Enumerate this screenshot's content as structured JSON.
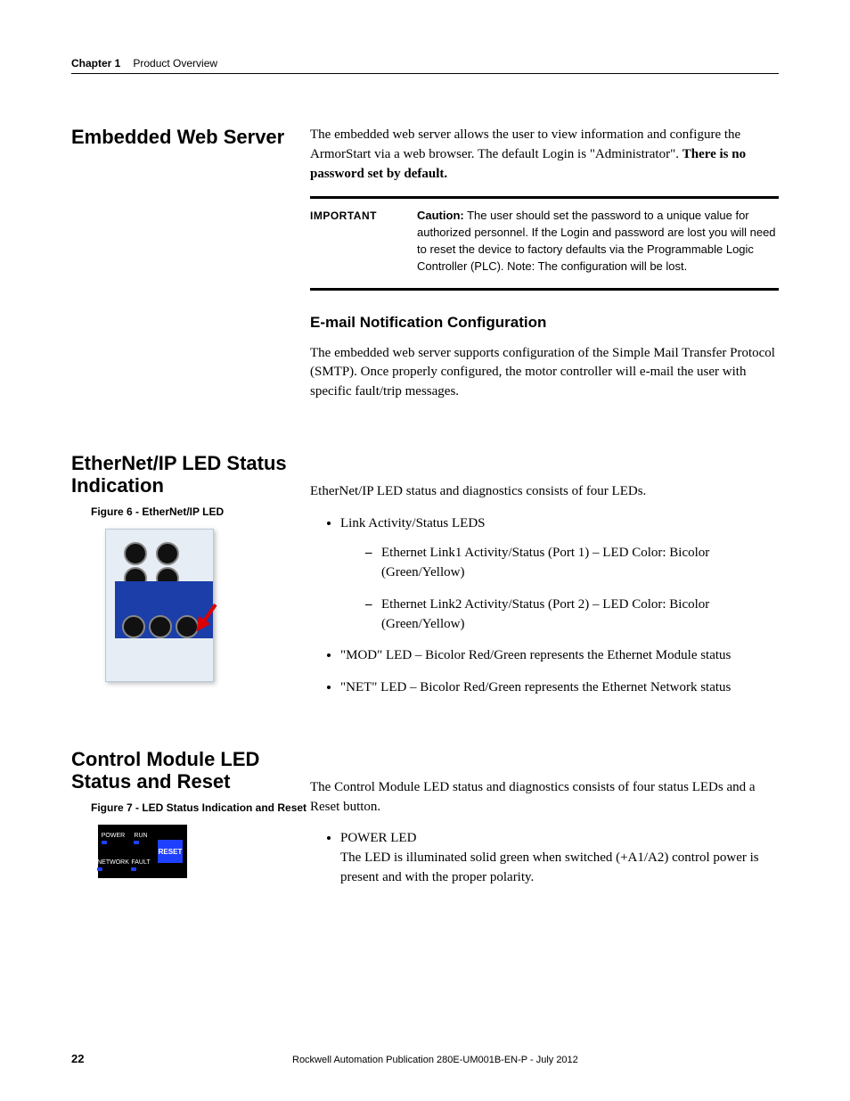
{
  "header": {
    "chapter": "Chapter 1",
    "title": "Product Overview"
  },
  "s1": {
    "heading": "Embedded Web Server",
    "para_prefix": "The embedded web server allows the user to view information and configure the ArmorStart via a web browser. The default Login is \"Administrator\". ",
    "para_bold": "There is no password set by default.",
    "important_label": "IMPORTANT",
    "important_caution": "Caution:",
    "important_text": " The user should set the password to a unique value for authorized personnel. If the Login and password are lost you will need to reset the device to factory defaults via the Programmable Logic Controller (PLC). Note: The configuration will be lost.",
    "sub_heading": "E-mail Notification Configuration",
    "sub_para": "The embedded web server supports configuration of the Simple Mail Transfer Protocol (SMTP). Once properly configured, the motor controller will e-mail the user with specific fault/trip messages."
  },
  "s2": {
    "heading": "EtherNet/IP LED Status Indication",
    "figcap": "Figure 6 - EtherNet/IP LED",
    "intro": "EtherNet/IP LED status and diagnostics consists of four LEDs.",
    "b1": "Link Activity/Status LEDS",
    "b1a": "Ethernet Link1 Activity/Status (Port 1) – LED Color: Bicolor (Green/Yellow)",
    "b1b": "Ethernet Link2 Activity/Status (Port 2) – LED Color: Bicolor (Green/Yellow)",
    "b2": "\"MOD\" LED – Bicolor Red/Green represents the Ethernet Module status",
    "b3": "\"NET\" LED – Bicolor Red/Green represents the Ethernet Network status"
  },
  "s3": {
    "heading": "Control Module LED Status and Reset",
    "figcap": "Figure 7 - LED Status Indication and Reset",
    "intro": "The Control Module LED status and diagnostics consists of four status LEDs and a Reset button.",
    "b1_label": "POWER LED",
    "b1_text": "The LED is illuminated solid green when switched (+A1/A2) control power is present and with the proper polarity.",
    "img_labels": {
      "power": "POWER",
      "run": "RUN",
      "network": "NETWORK",
      "fault": "FAULT",
      "reset": "RESET"
    }
  },
  "footer": {
    "page": "22",
    "pub": "Rockwell Automation Publication 280E-UM001B-EN-P - July 2012"
  }
}
